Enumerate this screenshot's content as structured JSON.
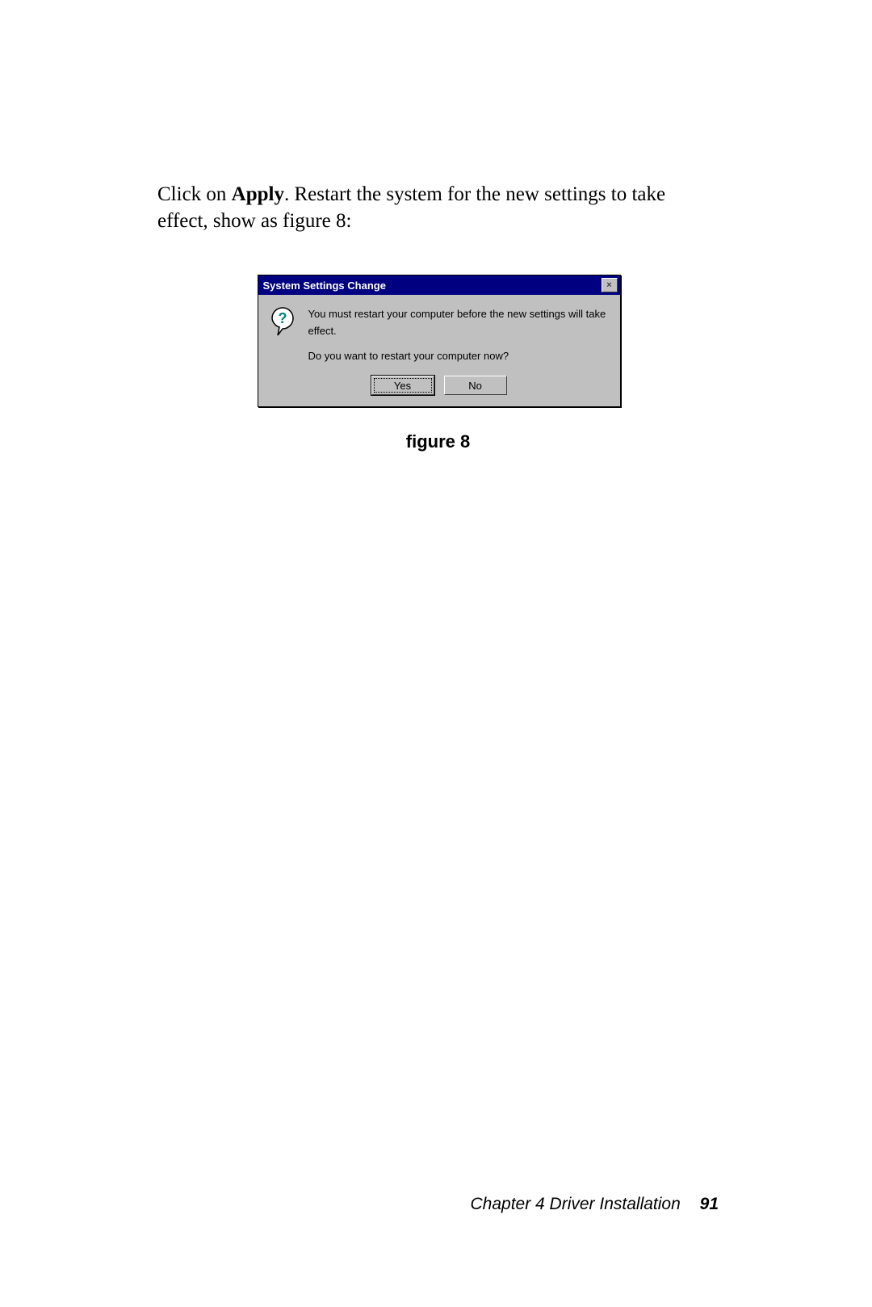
{
  "body": {
    "text_pre": "Click on ",
    "text_bold": "Apply",
    "text_post": ".  Restart the system for the new settings to take effect, show as figure 8:"
  },
  "dialog": {
    "title": "System Settings Change",
    "close_glyph": "×",
    "message_line1": "You must restart your computer before the new settings will take effect.",
    "message_line2": "Do you want to restart your computer now?",
    "yes_label": "Yes",
    "no_label": "No"
  },
  "caption": "figure 8",
  "footer": {
    "chapter": "Chapter 4  Driver Installation",
    "page": "91"
  }
}
